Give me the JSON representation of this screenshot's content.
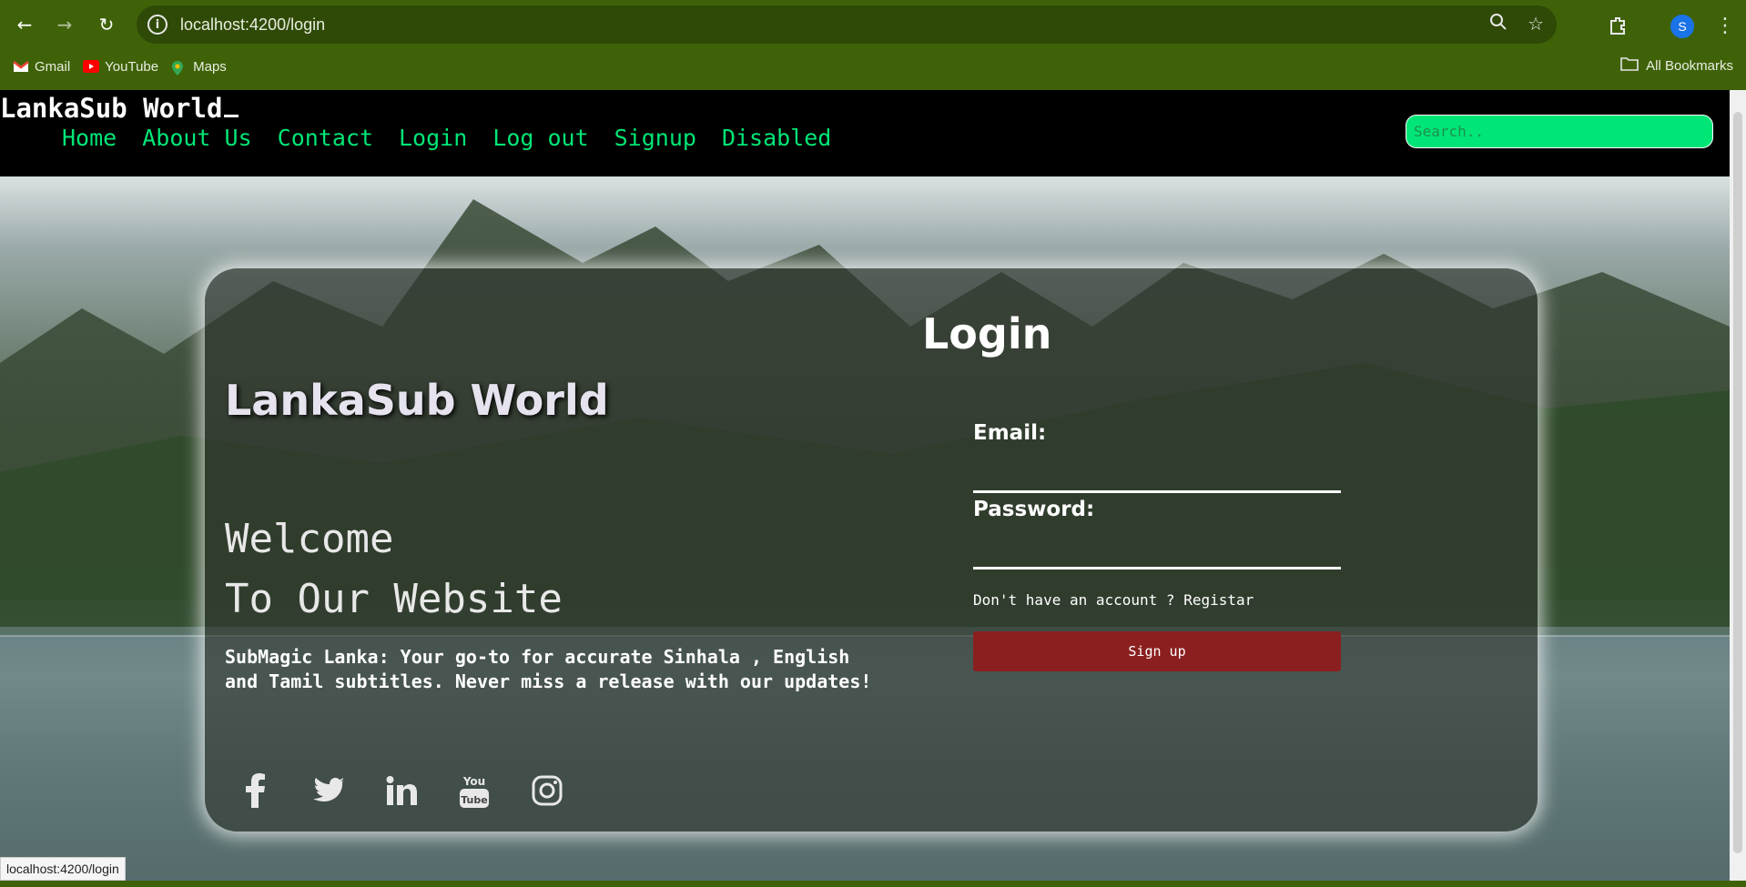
{
  "browser": {
    "url": "localhost:4200/login",
    "profile_initial": "S",
    "bookmarks": [
      {
        "label": "Gmail",
        "icon": "gmail-icon",
        "color": "#ea4335"
      },
      {
        "label": "YouTube",
        "icon": "youtube-icon",
        "color": "#ff0000"
      },
      {
        "label": "Maps",
        "icon": "maps-icon",
        "color": "#34a853"
      }
    ],
    "all_bookmarks_label": "All Bookmarks",
    "status_url": "localhost:4200/login"
  },
  "header": {
    "logo": "LankaSub World",
    "nav": [
      "Home",
      "About Us",
      "Contact",
      "Login",
      "Log out",
      "Signup",
      "Disabled"
    ],
    "search_placeholder": "Search.."
  },
  "hero": {
    "brand": "LankaSub World",
    "welcome_line1": "Welcome",
    "welcome_line2": "To Our Website",
    "description": "SubMagic Lanka: Your go-to for accurate Sinhala , English and Tamil subtitles. Never miss a release with our updates!",
    "socials": [
      "facebook-icon",
      "twitter-icon",
      "linkedin-icon",
      "youtube-icon",
      "instagram-icon"
    ]
  },
  "login": {
    "title": "Login",
    "email_label": "Email:",
    "password_label": "Password:",
    "register_text": "Don't have an account ? Registar",
    "button_label": "Sign up"
  },
  "colors": {
    "browser_frame": "#3f6209",
    "nav_link": "#00e676",
    "search_bg": "#00e676",
    "signup_button": "#8b1f1f"
  }
}
